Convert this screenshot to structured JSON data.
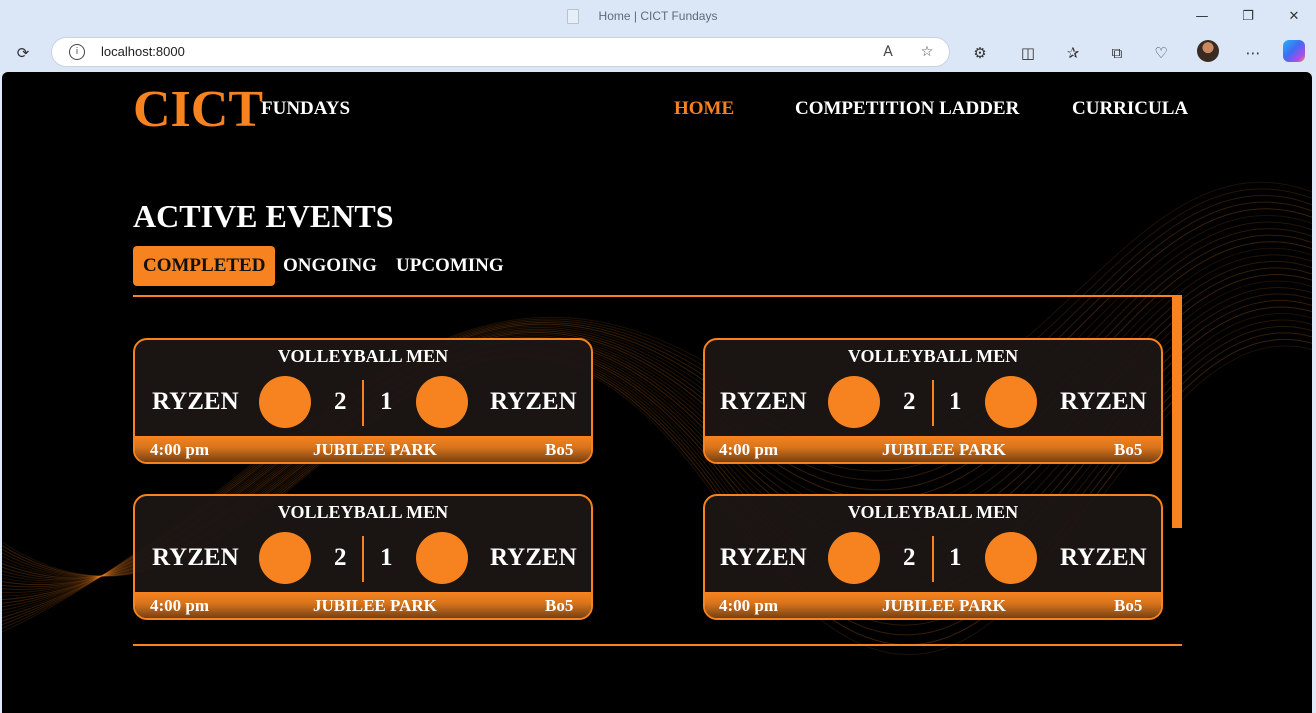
{
  "browser": {
    "tab_title": "Home | CICT Fundays",
    "url": "localhost:8000"
  },
  "nav": {
    "logo_big": "CICT",
    "logo_small": "FUNDAYS",
    "links": [
      "HOME",
      "COMPETITION LADDER",
      "CURRICULA"
    ],
    "active_link": "HOME"
  },
  "section": {
    "title": "ACTIVE EVENTS",
    "tabs": [
      "COMPLETED",
      "ONGOING",
      "UPCOMING"
    ],
    "active_tab": "COMPLETED"
  },
  "events": [
    {
      "title": "VOLLEYBALL MEN",
      "team_a": "RYZEN",
      "team_b": "RYZEN",
      "score_a": "2",
      "score_b": "1",
      "time": "4:00 pm",
      "venue": "JUBILEE PARK",
      "format": "Bo5"
    },
    {
      "title": "VOLLEYBALL MEN",
      "team_a": "RYZEN",
      "team_b": "RYZEN",
      "score_a": "2",
      "score_b": "1",
      "time": "4:00 pm",
      "venue": "JUBILEE PARK",
      "format": "Bo5"
    },
    {
      "title": "VOLLEYBALL MEN",
      "team_a": "RYZEN",
      "team_b": "RYZEN",
      "score_a": "2",
      "score_b": "1",
      "time": "4:00 pm",
      "venue": "JUBILEE PARK",
      "format": "Bo5"
    },
    {
      "title": "VOLLEYBALL MEN",
      "team_a": "RYZEN",
      "team_b": "RYZEN",
      "score_a": "2",
      "score_b": "1",
      "time": "4:00 pm",
      "venue": "JUBILEE PARK",
      "format": "Bo5"
    }
  ],
  "colors": {
    "accent": "#f6831f",
    "background": "#000000",
    "card_bg": "#1c1614"
  },
  "icons": {
    "window": [
      "minimize-icon",
      "restore-icon",
      "close-icon"
    ],
    "toolbar": [
      "refresh-icon",
      "info-icon",
      "read-aloud-icon",
      "favorite-star-icon",
      "extensions-icon",
      "split-screen-icon",
      "favorites-icon",
      "collections-icon",
      "browser-essentials-icon",
      "more-icon",
      "copilot-icon"
    ]
  }
}
